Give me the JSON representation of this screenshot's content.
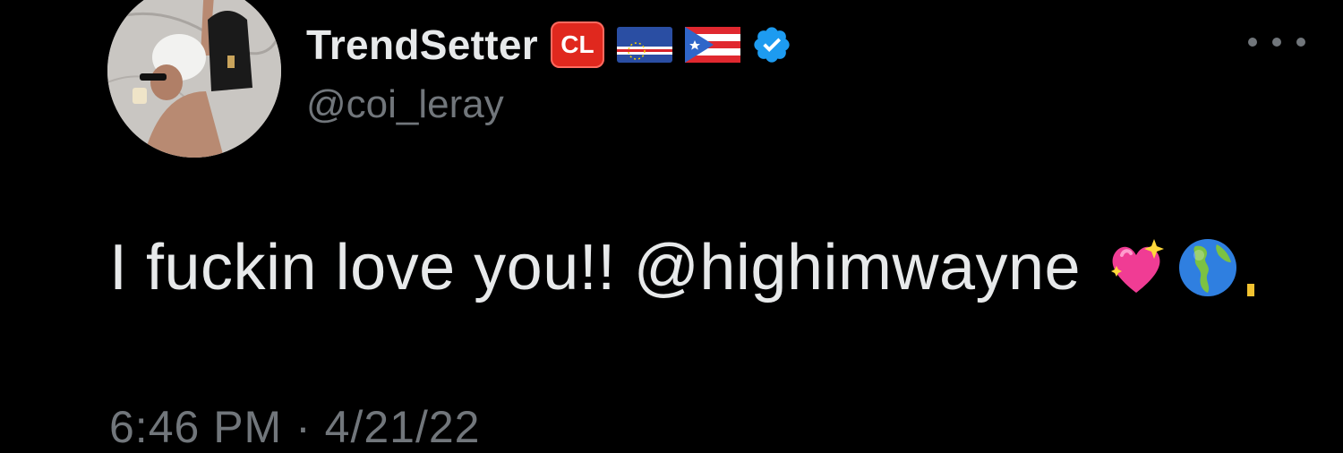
{
  "tweet": {
    "author": {
      "display_name": "TrendSetter",
      "badge_text": "CL",
      "handle": "@coi_leray",
      "flags": [
        "cape-verde-flag",
        "puerto-rico-flag"
      ],
      "verified_icon": "verified-check-icon"
    },
    "more_icon": "more-options-icon",
    "body": {
      "text": "I fuckin love you!!",
      "mention": "@highimwayne",
      "emojis": [
        "sparkling-heart-emoji",
        "globe-americas-emoji",
        "partial-emoji"
      ]
    },
    "timestamp": "6:46 PM · 4/21/22"
  },
  "colors": {
    "background": "#000000",
    "primary_text": "#e7e9ea",
    "secondary_text": "#71767b",
    "verified_blue": "#1d9bf0",
    "badge_red": "#e0281e"
  }
}
